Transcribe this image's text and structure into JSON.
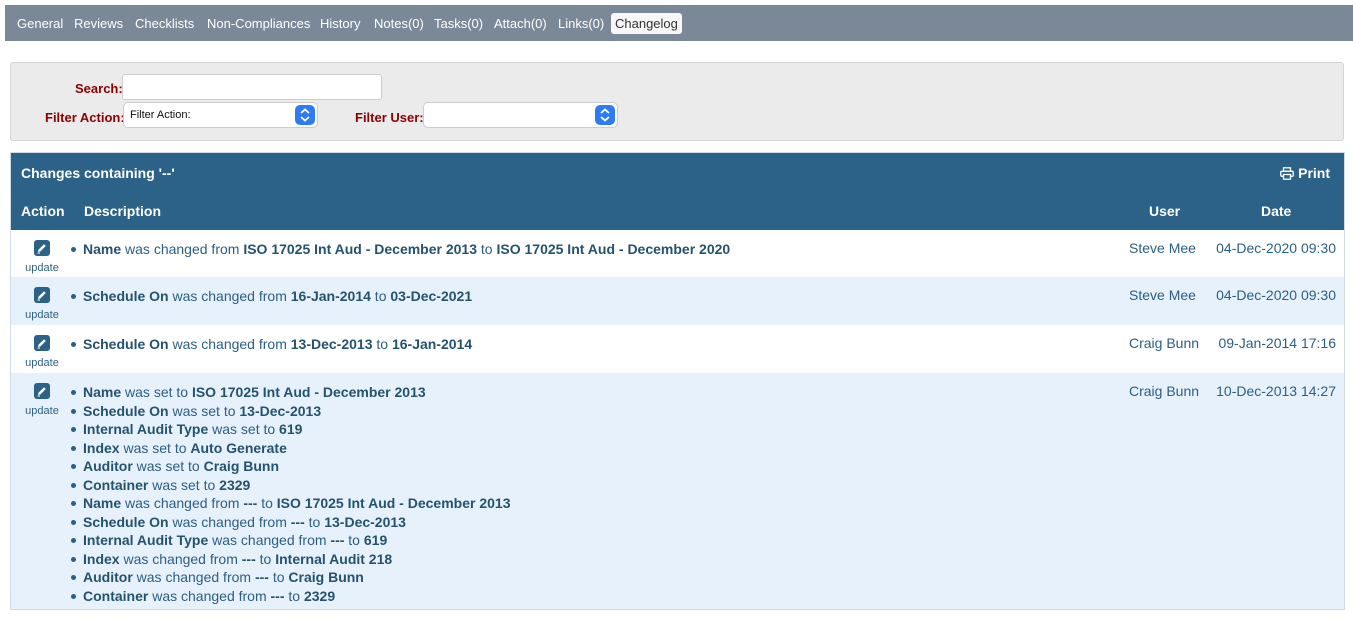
{
  "tabs": [
    "General",
    "Reviews",
    "Checklists",
    "Non-Compliances",
    "History",
    "Notes(0)",
    "Tasks(0)",
    "Attach(0)",
    "Links(0)",
    "Changelog"
  ],
  "filters": {
    "search_label": "Search:",
    "search_value": "",
    "action_label": "Filter Action:",
    "action_selected": "Filter Action:",
    "user_label": "Filter User:",
    "user_selected": ""
  },
  "table": {
    "caption": "Changes containing '--'",
    "print_label": "Print",
    "columns": {
      "action": "Action",
      "description": "Description",
      "user": "User",
      "date": "Date"
    },
    "rows": [
      {
        "action": "update",
        "user": "Steve Mee",
        "date": "04-Dec-2020 09:30",
        "changes": [
          {
            "field": "Name",
            "mid1": " was changed from ",
            "v1": "ISO 17025 Int Aud - December 2013",
            "mid2": " to ",
            "v2": "ISO 17025 Int Aud - December 2020"
          }
        ]
      },
      {
        "action": "update",
        "user": "Steve Mee",
        "date": "04-Dec-2020 09:30",
        "changes": [
          {
            "field": "Schedule On",
            "mid1": " was changed from ",
            "v1": "16-Jan-2014",
            "mid2": " to ",
            "v2": "03-Dec-2021"
          }
        ]
      },
      {
        "action": "update",
        "user": "Craig Bunn",
        "date": "09-Jan-2014 17:16",
        "changes": [
          {
            "field": "Schedule On",
            "mid1": " was changed from ",
            "v1": "13-Dec-2013",
            "mid2": " to ",
            "v2": "16-Jan-2014"
          }
        ]
      },
      {
        "action": "update",
        "user": "Craig Bunn",
        "date": "10-Dec-2013 14:27",
        "changes": [
          {
            "field": "Name",
            "mid1": " was set to ",
            "v1": "ISO 17025 Int Aud - December 2013"
          },
          {
            "field": "Schedule On",
            "mid1": " was set to ",
            "v1": "13-Dec-2013"
          },
          {
            "field": "Internal Audit Type",
            "mid1": " was set to ",
            "v1": "619"
          },
          {
            "field": "Index",
            "mid1": " was set to ",
            "v1": "Auto Generate"
          },
          {
            "field": "Auditor",
            "mid1": " was set to ",
            "v1": "Craig Bunn"
          },
          {
            "field": "Container",
            "mid1": " was set to ",
            "v1": "2329"
          },
          {
            "field": "Name",
            "mid1": " was changed from ",
            "v1": "---",
            "mid2": " to ",
            "v2": "ISO 17025 Int Aud - December 2013"
          },
          {
            "field": "Schedule On",
            "mid1": " was changed from ",
            "v1": "---",
            "mid2": " to ",
            "v2": "13-Dec-2013"
          },
          {
            "field": "Internal Audit Type",
            "mid1": " was changed from ",
            "v1": "---",
            "mid2": " to ",
            "v2": "619"
          },
          {
            "field": "Index",
            "mid1": " was changed from ",
            "v1": "---",
            "mid2": " to ",
            "v2": "Internal Audit 218"
          },
          {
            "field": "Auditor",
            "mid1": " was changed from ",
            "v1": "---",
            "mid2": " to ",
            "v2": "Craig Bunn"
          },
          {
            "field": "Container",
            "mid1": " was changed from ",
            "v1": "---",
            "mid2": " to ",
            "v2": "2329"
          }
        ]
      }
    ]
  }
}
